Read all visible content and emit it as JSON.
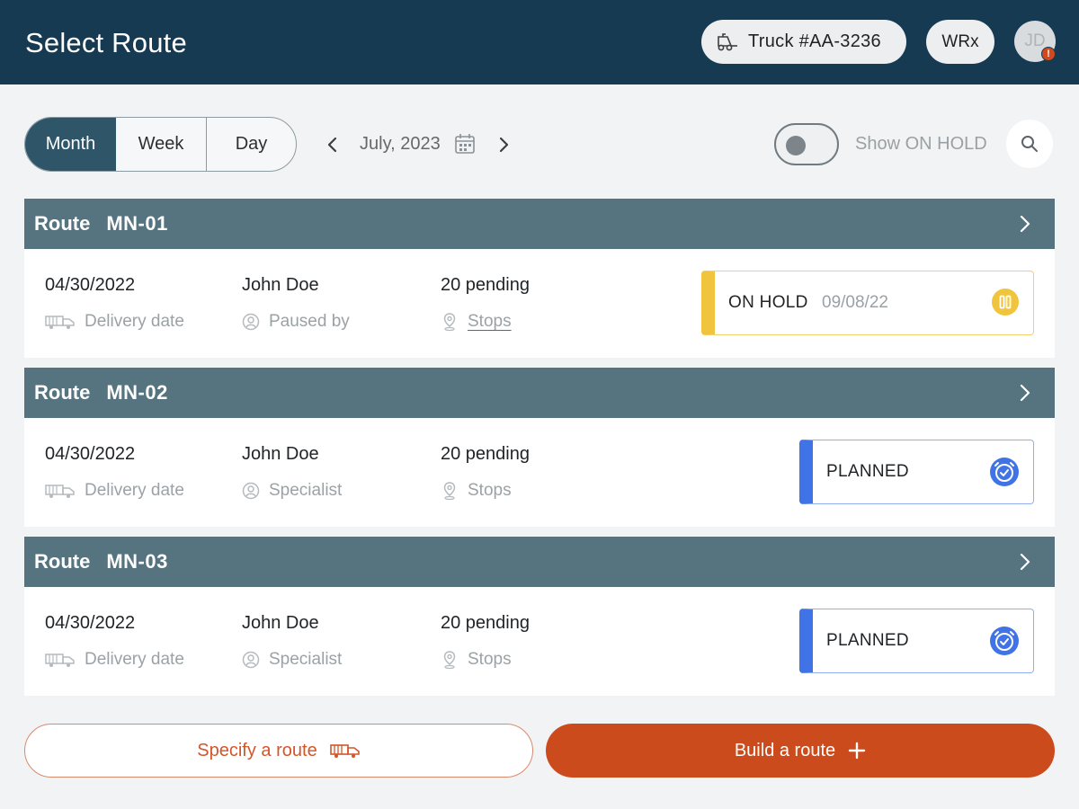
{
  "header": {
    "title": "Select Route",
    "truck_label": "Truck #AA-3236",
    "org_label": "WRx",
    "avatar_initials": "JD",
    "notification_count": "!"
  },
  "filters": {
    "tabs": [
      "Month",
      "Week",
      "Day"
    ],
    "selected_tab": "Month",
    "period_label": "July, 2023",
    "toggle_label": "Show ON HOLD",
    "toggle_on": false
  },
  "routes": [
    {
      "label": "Route",
      "id": "MN-01",
      "date": "04/30/2022",
      "date_caption": "Delivery date",
      "person": "John Doe",
      "person_caption": "Paused by",
      "pending": "20 pending",
      "stops_caption": "Stops",
      "status": "ON HOLD",
      "status_date": "09/08/22",
      "status_icon": "pause-icon"
    },
    {
      "label": "Route",
      "id": "MN-02",
      "date": "04/30/2022",
      "date_caption": "Delivery date",
      "person": "John Doe",
      "person_caption": "Specialist",
      "pending": "20 pending",
      "stops_caption": "Stops",
      "status": "PLANNED",
      "status_icon": "alarm-check-icon"
    },
    {
      "label": "Route",
      "id": "MN-03",
      "date": "04/30/2022",
      "date_caption": "Delivery date",
      "person": "John Doe",
      "person_caption": "Specialist",
      "pending": "20 pending",
      "stops_caption": "Stops",
      "status": "PLANNED",
      "status_icon": "alarm-check-icon"
    }
  ],
  "actions": {
    "specify_label": "Specify a route",
    "build_label": "Build a route"
  },
  "colors": {
    "header_bg": "#163a52",
    "route_header_bg": "#557480",
    "accent_orange": "#cc4b1d",
    "on_hold_yellow": "#f0c43c",
    "planned_blue": "#3f73e6"
  }
}
